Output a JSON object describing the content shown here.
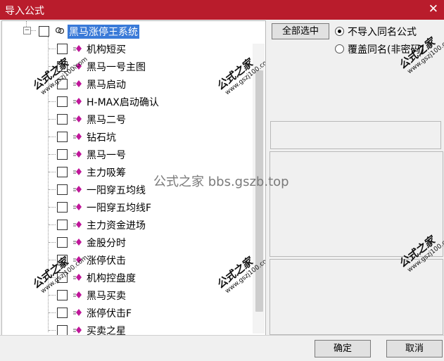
{
  "window": {
    "title": "导入公式",
    "close_glyph": "✕"
  },
  "tree": {
    "root": {
      "label": "黑马涨停王系统",
      "expander": "−"
    },
    "items": [
      {
        "label": "机构短买"
      },
      {
        "label": "黑马一号主图"
      },
      {
        "label": "黑马启动"
      },
      {
        "label": "H-MAX启动确认"
      },
      {
        "label": "黑马二号"
      },
      {
        "label": "钻石坑"
      },
      {
        "label": "黑马一号"
      },
      {
        "label": "主力吸筹"
      },
      {
        "label": "一阳穿五均线"
      },
      {
        "label": "一阳穿五均线F"
      },
      {
        "label": "主力资金进场"
      },
      {
        "label": "金股分时"
      },
      {
        "label": "涨停伏击"
      },
      {
        "label": "机构控盘度"
      },
      {
        "label": "黑马买卖"
      },
      {
        "label": "涨停伏击F"
      },
      {
        "label": "买卖之星"
      }
    ]
  },
  "right": {
    "select_all_label": "全部选中",
    "option_skip_label": "不导入同名公式",
    "option_overwrite_label": "覆盖同名(非密码)",
    "selected_option": "skip"
  },
  "footer": {
    "ok_label": "确定",
    "cancel_label": "取消"
  },
  "watermark": {
    "center": "公式之家 bbs.gszb.top",
    "stamp_title": "公式之家",
    "stamp_url": "www.gszj100.com"
  },
  "colors": {
    "titlebar": "#b91c2c",
    "selection": "#3a7ad8",
    "formula_icon": "#c0169a"
  }
}
